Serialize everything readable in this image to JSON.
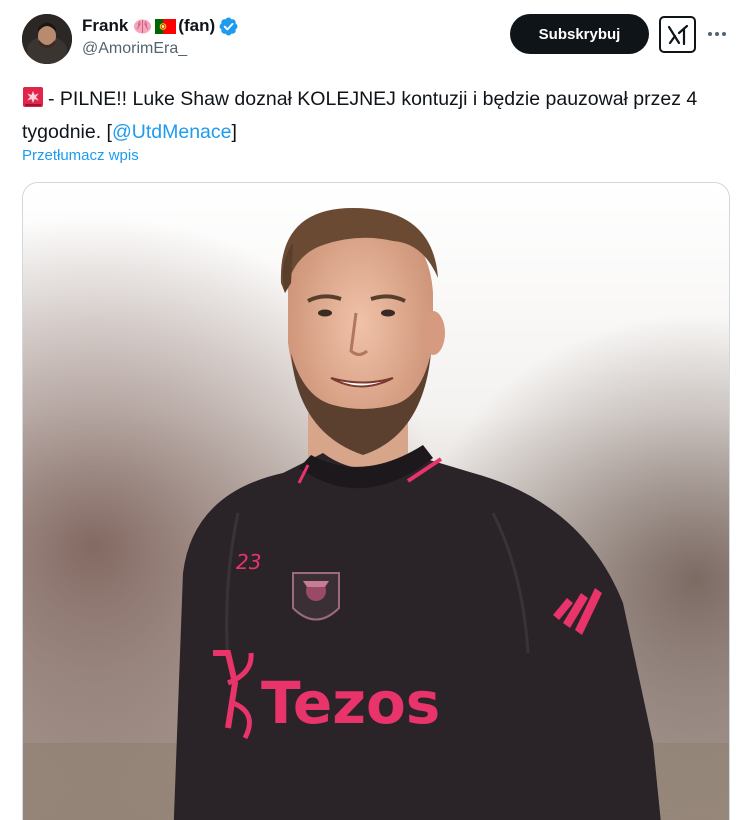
{
  "author": {
    "display_name": "Frank",
    "fan_label": "(fan)",
    "handle": "@AmorimEra_",
    "emoji_icons": [
      "brain-icon",
      "portugal-flag-icon"
    ],
    "verified": true
  },
  "actions": {
    "subscribe_label": "Subskrybuj",
    "grok_icon": "grok-icon",
    "more_icon": "more-icon"
  },
  "tweet": {
    "emoji": "siren-icon",
    "text_main": "- PILNE!! Luke Shaw doznał KOLEJNEJ kontuzji i będzie pauzował przez 4 tygodnie. [",
    "mention": "@UtdMenace",
    "text_end": "]",
    "translate_label": "Przetłumacz wpis"
  },
  "media": {
    "shirt_number": "23",
    "sponsor": "Tezos"
  },
  "colors": {
    "accent": "#1d9bf0",
    "text": "#0f1419",
    "secondary": "#536471",
    "verified": "#1d9bf0",
    "kit_pink": "#e8336b"
  }
}
